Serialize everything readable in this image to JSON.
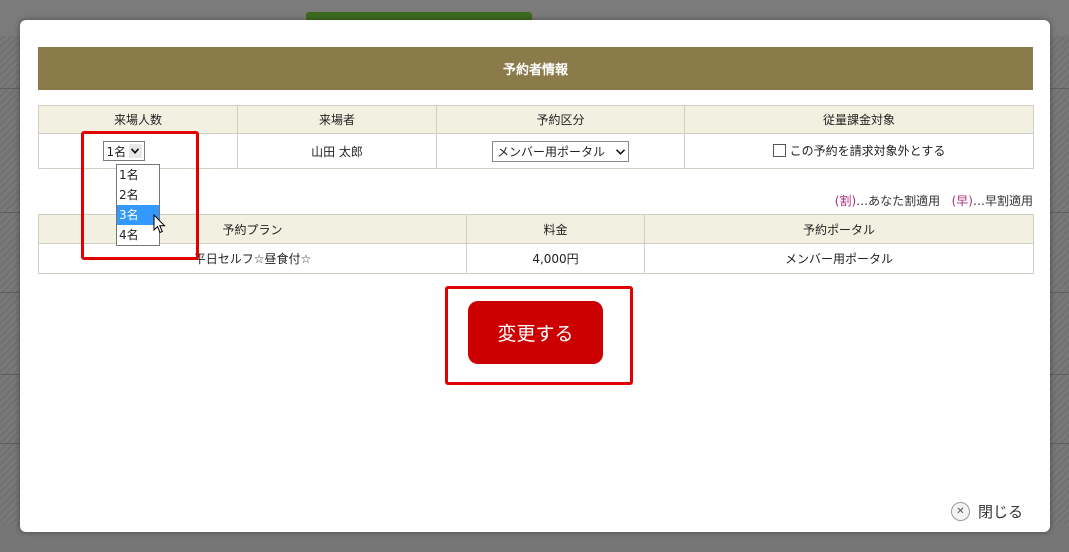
{
  "modal": {
    "title": "予約者情報",
    "reservation_table": {
      "headers": [
        "来場人数",
        "来場者",
        "予約区分",
        "従量課金対象"
      ],
      "visitor_count_selected": "1名",
      "visitor_name": "山田 太郎",
      "reservation_type_selected": "メンバー用ポータル",
      "exclude_billing_label": "この予約を請求対象外とする"
    },
    "dropdown_options": [
      "1名",
      "2名",
      "3名",
      "4名"
    ],
    "highlighted_option": "3名",
    "legend": {
      "discount_mark": "(割)",
      "discount_text": "…あなた割適用",
      "early_mark": "(早)",
      "early_text": "…早割適用"
    },
    "plan_table": {
      "headers": [
        "予約プラン",
        "料金",
        "予約ポータル"
      ],
      "plan": "平日セルフ☆昼食付☆",
      "price": "4,000円",
      "portal": "メンバー用ポータル"
    },
    "change_button": "変更する",
    "close_button": "閉じる"
  },
  "icons": {
    "chevron": "chevron-down-icon",
    "close": "close-icon",
    "cursor": "mouse-pointer-icon"
  },
  "colors": {
    "header_bg": "#8b7b4b",
    "button_bg": "#cc0000",
    "highlight_box": "#e00000",
    "legend_mark": "#b0307a",
    "selected_option": "#3399ff"
  }
}
